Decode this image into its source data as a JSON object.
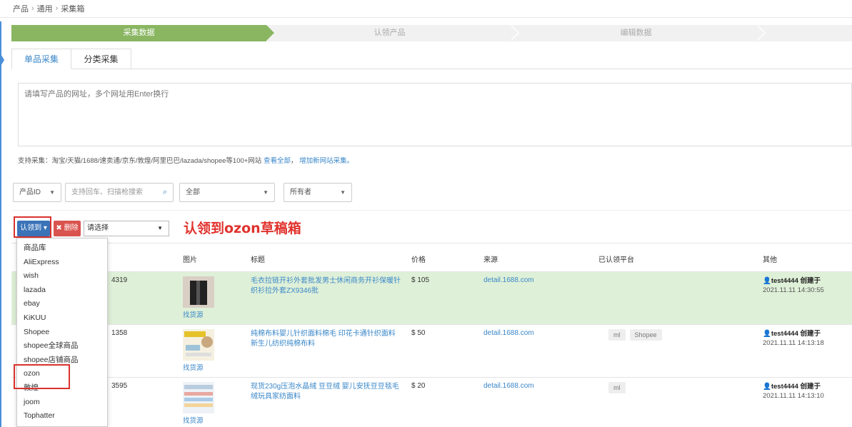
{
  "breadcrumb": [
    "产品",
    "通用",
    "采集箱"
  ],
  "breadcrumb_sep": "›",
  "steps": [
    "采集数据",
    "认领产品",
    "编辑数据"
  ],
  "tabs": [
    "单品采集",
    "分类采集"
  ],
  "url_input": {
    "placeholder": "请填写产品的网址，多个网址用Enter换行"
  },
  "support": {
    "text": "支持采集：淘宝/天猫/1688/速卖通/京东/敦煌/阿里巴巴/lazada/shopee等100+网站",
    "link_all": "查看全部",
    "link_add": "增加新网站采集。"
  },
  "filters": {
    "id_select": "产品ID",
    "search_placeholder": "支持回车、扫描枪搜索",
    "status_select": "全部",
    "owner_select": "所有者"
  },
  "toolbar": {
    "claim_button": "认领到",
    "delete_button": "删除",
    "select_placeholder": "请选择"
  },
  "annotation": "认领到ozon草稿箱",
  "table": {
    "headers": {
      "image": "图片",
      "title": "标题",
      "price": "价格",
      "source": "来源",
      "platforms": "已认领平台",
      "other": "其他"
    },
    "find_source_label": "找货源",
    "rows": [
      {
        "id": "4319",
        "title": "毛衣拉链开衫外套批发男士休闲商务开衫保暖针织衫拉外套ZX9346批",
        "price": "$ 105",
        "source": "detail.1688.com",
        "platforms": [],
        "creator": "test4444",
        "created_label": "创建于",
        "time": "2021.11.11 14:30:55"
      },
      {
        "id": "1358",
        "title": "纯棉布料婴儿针织面料棉毛 印花卡通针织面料 新生儿纺织纯棉布料",
        "price": "$ 50",
        "source": "detail.1688.com",
        "platforms": [
          "ml",
          "Shopee"
        ],
        "creator": "test4444",
        "created_label": "创建于",
        "time": "2021.11.11 14:13:18"
      },
      {
        "id": "3595",
        "title": "现货230g压泡水晶绒 豆豆绒 婴儿安抚豆豆毯毛绒玩具家纺面料",
        "price": "$ 20",
        "source": "detail.1688.com",
        "platforms": [
          "ml"
        ],
        "creator": "test4444",
        "created_label": "创建于",
        "time": "2021.11.11 14:13:10"
      }
    ]
  },
  "dropdown": [
    "商品库",
    "AliExpress",
    "wish",
    "lazada",
    "ebay",
    "KiKUU",
    "Shopee",
    "shopee全球商品",
    "shopee店铺商品",
    "ozon",
    "敦煌",
    "joom",
    "Tophatter"
  ]
}
